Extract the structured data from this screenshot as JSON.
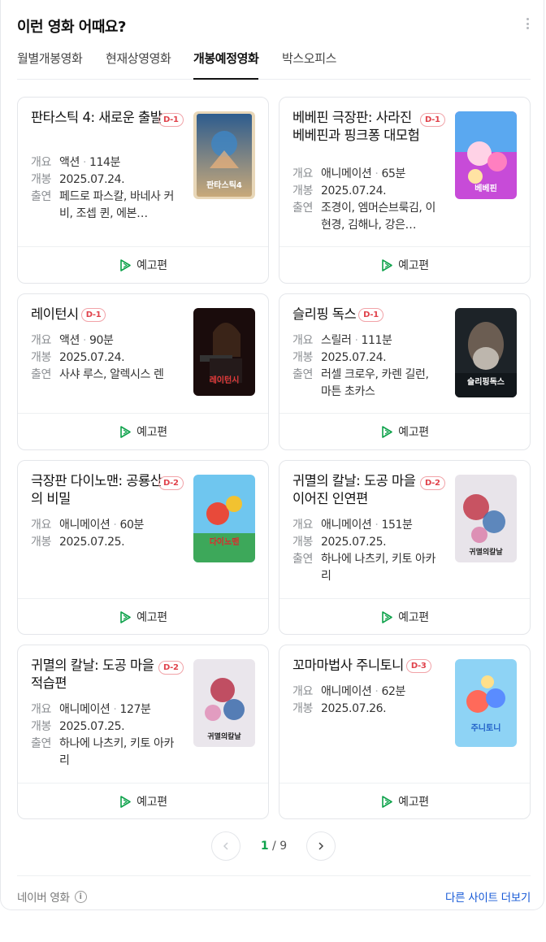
{
  "header": {
    "title": "이런 영화 어때요?"
  },
  "tabs": [
    {
      "label": "월별개봉영화"
    },
    {
      "label": "현재상영영화"
    },
    {
      "label": "개봉예정영화"
    },
    {
      "label": "박스오피스"
    }
  ],
  "labels": {
    "genre": "개요",
    "release": "개봉",
    "cast": "출연",
    "trailer": "예고편"
  },
  "movies": [
    {
      "title": "판타스틱 4: 새로운 출발",
      "badge": "D-1",
      "genre": "액션",
      "runtime": "114분",
      "release": "2025.07.24.",
      "cast": "페드로 파스칼, 바네사 커비, 조셉 퀸, 에본…"
    },
    {
      "title": "베베핀 극장판: 사라진 베베핀과 핑크퐁 대모험",
      "badge": "D-1",
      "genre": "애니메이션",
      "runtime": "65분",
      "release": "2025.07.24.",
      "cast": "조경이, 엠머슨브룩김, 이현경, 김해나, 강은…"
    },
    {
      "title": "레이턴시",
      "badge": "D-1",
      "genre": "액션",
      "runtime": "90분",
      "release": "2025.07.24.",
      "cast": "사샤 루스, 알렉시스 렌"
    },
    {
      "title": "슬리핑 독스",
      "badge": "D-1",
      "genre": "스릴러",
      "runtime": "111분",
      "release": "2025.07.24.",
      "cast": "러셀 크로우, 카렌 길런, 마튼 초카스"
    },
    {
      "title": "극장판 다이노맨: 공룡산의 비밀",
      "badge": "D-2",
      "genre": "애니메이션",
      "runtime": "60분",
      "release": "2025.07.25."
    },
    {
      "title": "귀멸의 칼날: 도공 마을 이어진 인연편",
      "badge": "D-2",
      "genre": "애니메이션",
      "runtime": "151분",
      "release": "2025.07.25.",
      "cast": "하나에 나츠키, 키토 아카리"
    },
    {
      "title": "귀멸의 칼날: 도공 마을 적습편",
      "badge": "D-2",
      "genre": "애니메이션",
      "runtime": "127분",
      "release": "2025.07.25.",
      "cast": "하나에 나츠키, 키토 아카리"
    },
    {
      "title": "꼬마마법사 주니토니",
      "badge": "D-3",
      "genre": "애니메이션",
      "runtime": "62분",
      "release": "2025.07.26."
    }
  ],
  "poster_text": {
    "p1": "판타스틱4",
    "p2": "베베핀",
    "p3": "레이턴시",
    "p4": "슬리핑독스",
    "p5": "다이노맨",
    "p6": "귀멸의칼날",
    "p7": "귀멸의칼날",
    "p8": "주니토니"
  },
  "pagination": {
    "current": "1",
    "separator": "/",
    "total": "9"
  },
  "footer": {
    "source": "네이버 영화",
    "more": "다른 사이트 더보기"
  },
  "colors": {
    "accent": "#0ea24b",
    "badge": "#e0424b",
    "link": "#1558d6"
  }
}
